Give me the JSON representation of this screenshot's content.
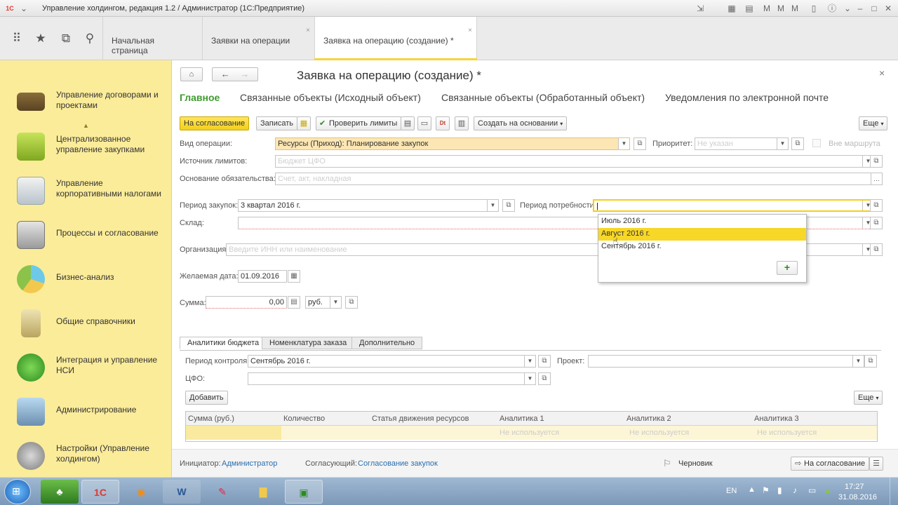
{
  "window": {
    "title": "Управление холдингом, редакция 1.2 / Администратор  (1С:Предприятие)"
  },
  "tabs": [
    {
      "label": "Начальная страница"
    },
    {
      "label": "Заявки на операции"
    },
    {
      "label": "Заявка на операцию (создание) *"
    }
  ],
  "sidebar": {
    "items": [
      {
        "label": "Управление договорами и проектами",
        "icon": "briefcase-icon"
      },
      {
        "label": "Централизованное управление закупками",
        "icon": "gift-box-icon"
      },
      {
        "label": "Управление корпоративными налогами",
        "icon": "documents-icon"
      },
      {
        "label": "Процессы и согласование",
        "icon": "checklist-icon"
      },
      {
        "label": "Бизнес-анализ",
        "icon": "pie-chart-icon"
      },
      {
        "label": "Общие справочники",
        "icon": "cabinet-icon"
      },
      {
        "label": "Интеграция и управление НСИ",
        "icon": "sync-circle-icon"
      },
      {
        "label": "Администрирование",
        "icon": "computer-icon"
      },
      {
        "label": "Настройки (Управление холдингом)",
        "icon": "gears-icon"
      }
    ]
  },
  "form": {
    "title": "Заявка на операцию (создание) *",
    "nav_tabs": [
      "Главное",
      "Связанные объекты (Исходный объект)",
      "Связанные объекты (Обработанный объект)",
      "Уведомления по электронной почте"
    ],
    "toolbar": {
      "approve": "На согласование",
      "save": "Записать",
      "check_limits": "Проверить лимиты",
      "create_based": "Создать на основании",
      "more": "Еще"
    },
    "fields": {
      "op_type_label": "Вид операции:",
      "op_type_value": "Ресурсы (Приход): Планирование закупок",
      "priority_label": "Приоритет:",
      "priority_placeholder": "Не указан",
      "out_route_label": "Вне маршрута",
      "limit_source_label": "Источник лимитов:",
      "limit_source_placeholder": "Бюджет ЦФО",
      "obligation_basis_label": "Основание обязательства:",
      "obligation_basis_placeholder": "Счет, акт, накладная",
      "purchase_period_label": "Период закупок:",
      "purchase_period_value": "3 квартал 2016 г.",
      "need_period_label": "Период потребности:",
      "warehouse_label": "Склад:",
      "org_label": "Организация:",
      "org_placeholder": "Введите ИНН или наименование",
      "desired_date_label": "Желаемая дата:",
      "desired_date_value": "01.09.2016",
      "sum_label": "Сумма:",
      "sum_value": "0,00",
      "currency_value": "руб."
    },
    "dropdown": {
      "options": [
        "Июль 2016 г.",
        "Август 2016 г.",
        "Сентябрь 2016 г."
      ],
      "selected": "Август 2016 г."
    },
    "subtabs": [
      "Аналитики бюджета",
      "Номенклатура заказа",
      "Дополнительно"
    ],
    "budget": {
      "control_period_label": "Период контроля:",
      "control_period_value": "Сентябрь 2016 г.",
      "project_label": "Проект:",
      "cfo_label": "ЦФО:",
      "add_button": "Добавить",
      "more": "Еще"
    },
    "table": {
      "columns": [
        "Сумма (руб.)",
        "Количество",
        "Статья движения ресурсов",
        "Аналитика 1",
        "Аналитика 2",
        "Аналитика 3"
      ],
      "row_placeholders": [
        "",
        "",
        "",
        "Не используется",
        "Не используется",
        "Не используется"
      ]
    },
    "footer": {
      "initiator_label": "Инициатор:",
      "initiator_value": "Администратор",
      "approver_label": "Согласующий:",
      "approver_value": "Согласование закупок",
      "status": "Черновик",
      "approve_button": "На согласование"
    }
  },
  "taskbar": {
    "lang": "EN",
    "time": "17:27",
    "date": "31.08.2016"
  }
}
